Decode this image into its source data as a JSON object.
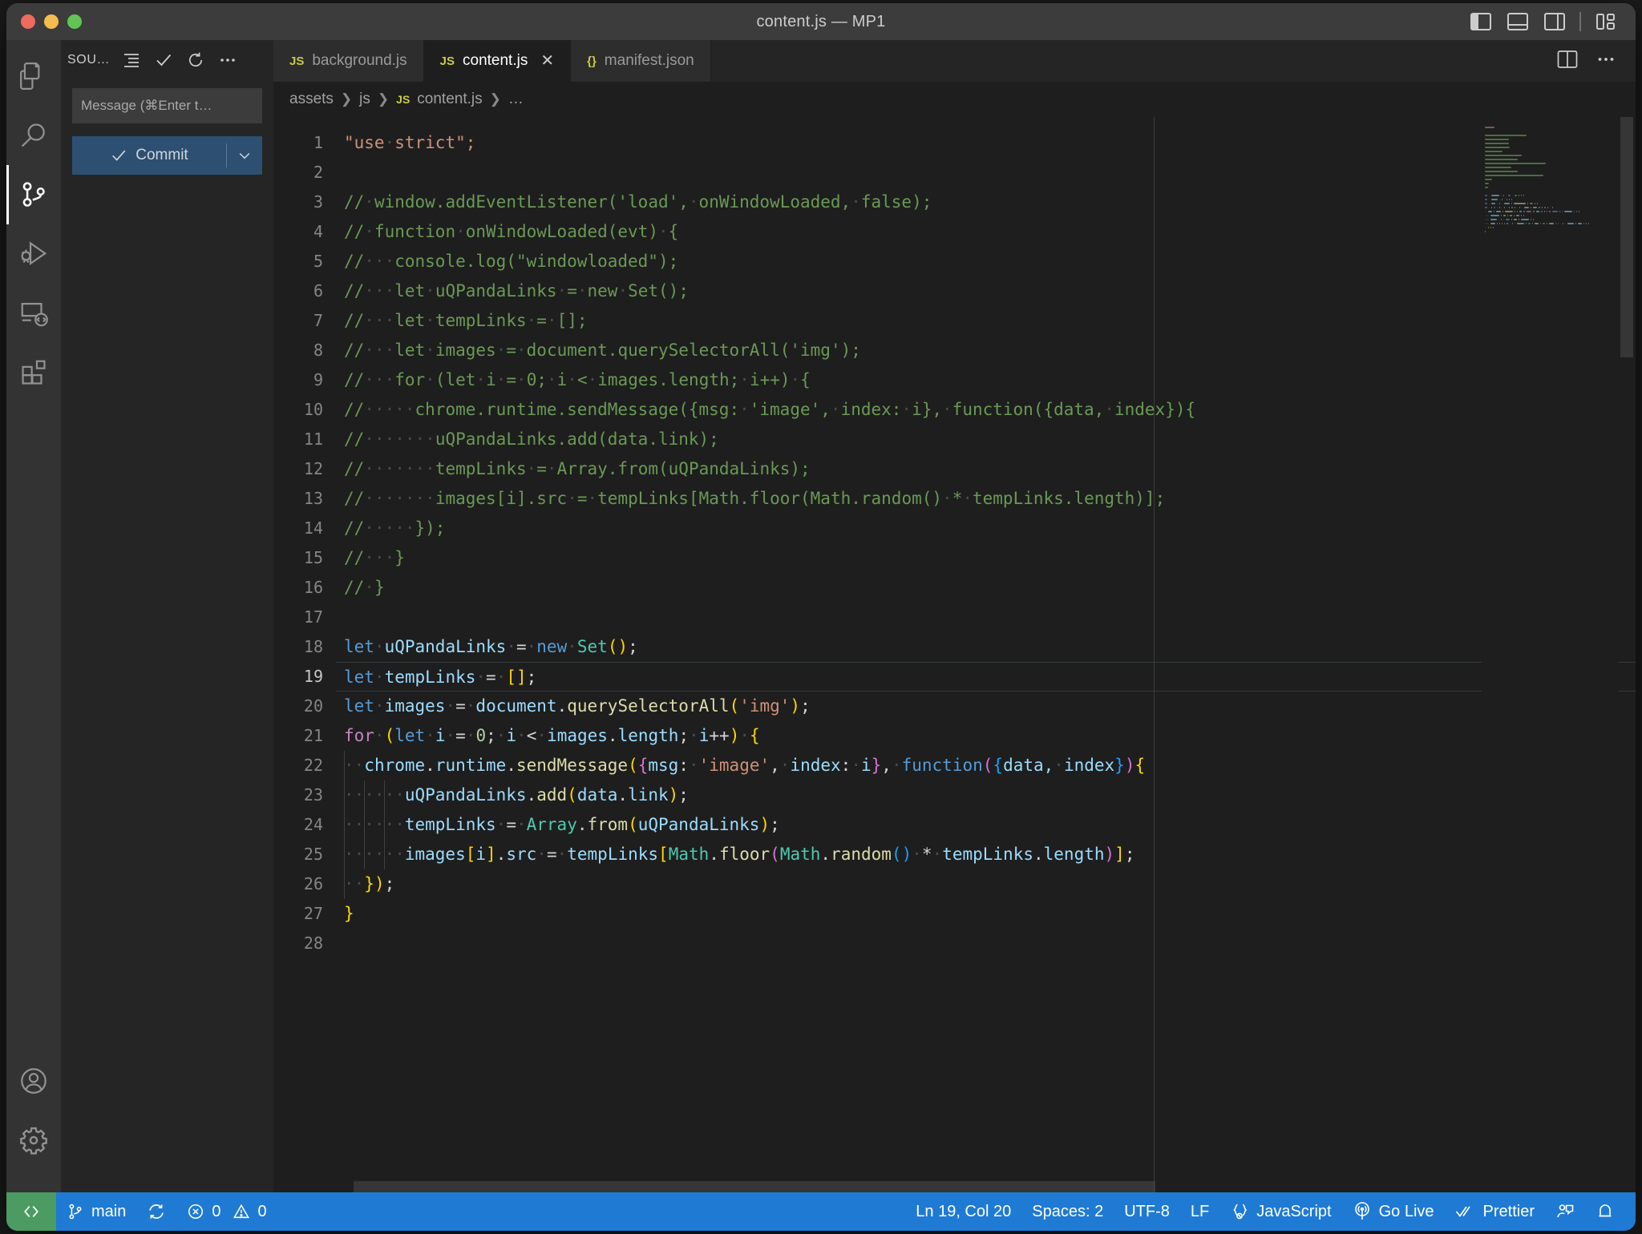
{
  "window": {
    "title": "content.js — MP1",
    "traffic_lights": [
      "close-red",
      "minimize-yellow",
      "maximize-green"
    ],
    "layout_actions": [
      {
        "name": "toggle-primary-sidebar",
        "state": "active"
      },
      {
        "name": "toggle-panel",
        "state": "inactive"
      },
      {
        "name": "toggle-secondary-sidebar",
        "state": "inactive"
      },
      {
        "name": "customize-layout",
        "state": "inactive"
      }
    ]
  },
  "activity_bar": {
    "items": [
      {
        "name": "explorer",
        "icon": "files-icon",
        "active": false
      },
      {
        "name": "search",
        "icon": "search-icon",
        "active": false
      },
      {
        "name": "source-control",
        "icon": "source-control-icon",
        "active": true
      },
      {
        "name": "run-and-debug",
        "icon": "run-debug-icon",
        "active": false
      },
      {
        "name": "remote-explorer",
        "icon": "remote-explorer-icon",
        "active": false
      },
      {
        "name": "extensions",
        "icon": "extensions-icon",
        "active": false
      }
    ],
    "bottom": [
      {
        "name": "accounts",
        "icon": "account-icon"
      },
      {
        "name": "manage",
        "icon": "gear-icon"
      }
    ]
  },
  "sidebar": {
    "title": "SOU…",
    "actions": [
      {
        "name": "view-as-tree",
        "icon": "list-flat-icon"
      },
      {
        "name": "commit",
        "icon": "check-icon"
      },
      {
        "name": "refresh",
        "icon": "refresh-icon"
      },
      {
        "name": "views-and-more-actions",
        "icon": "ellipsis-icon"
      }
    ],
    "message_input": {
      "value": "",
      "placeholder": "Message (⌘Enter t…"
    },
    "commit_button": {
      "label": "Commit",
      "icon": "check-icon",
      "dropdown_icon": "chevron-down-icon",
      "color": "#2d4f72"
    }
  },
  "tabs": [
    {
      "label": "background.js",
      "icon": "js-file-icon",
      "icon_text": "JS",
      "active": false,
      "closable": false
    },
    {
      "label": "content.js",
      "icon": "js-file-icon",
      "icon_text": "JS",
      "active": true,
      "closable": true,
      "close_glyph": "✕"
    },
    {
      "label": "manifest.json",
      "icon": "json-file-icon",
      "icon_text": "{}",
      "active": false,
      "closable": false
    }
  ],
  "tabbar_actions": [
    {
      "name": "split-editor-right",
      "icon": "split-editor-icon"
    },
    {
      "name": "more-editor-actions",
      "icon": "ellipsis-icon"
    }
  ],
  "breadcrumb": {
    "items": [
      "assets",
      "js",
      "content.js",
      "…"
    ],
    "file_icon_text": "JS",
    "separator": "❯"
  },
  "editor": {
    "language_icon": "js",
    "lines": [
      {
        "n": 1,
        "tokens": [
          {
            "t": "\"use·strict\";",
            "c": "t-str"
          }
        ]
      },
      {
        "n": 2,
        "tokens": []
      },
      {
        "n": 3,
        "tokens": [
          {
            "t": "//·window.addEventListener('load',·onWindowLoaded,·false);",
            "c": "t-cmt"
          }
        ]
      },
      {
        "n": 4,
        "tokens": [
          {
            "t": "//·function·onWindowLoaded(evt)·{",
            "c": "t-cmt"
          }
        ]
      },
      {
        "n": 5,
        "tokens": [
          {
            "t": "//···console.log(\"windowloaded\");",
            "c": "t-cmt"
          }
        ]
      },
      {
        "n": 6,
        "tokens": [
          {
            "t": "//···let·uQPandaLinks·=·new·Set();",
            "c": "t-cmt"
          }
        ]
      },
      {
        "n": 7,
        "tokens": [
          {
            "t": "//···let·tempLinks·=·[];",
            "c": "t-cmt"
          }
        ]
      },
      {
        "n": 8,
        "tokens": [
          {
            "t": "//···let·images·=·document.querySelectorAll('img');",
            "c": "t-cmt"
          }
        ]
      },
      {
        "n": 9,
        "tokens": [
          {
            "t": "//···for·(let·i·=·0;·i·<·images.length;·i++)·{",
            "c": "t-cmt"
          }
        ]
      },
      {
        "n": 10,
        "tokens": [
          {
            "t": "//·····chrome.runtime.sendMessage({msg:·'image',·index:·i},·function({data,·index}){",
            "c": "t-cmt"
          }
        ]
      },
      {
        "n": 11,
        "tokens": [
          {
            "t": "//·······uQPandaLinks.add(data.link);",
            "c": "t-cmt"
          }
        ]
      },
      {
        "n": 12,
        "tokens": [
          {
            "t": "//·······tempLinks·=·Array.from(uQPandaLinks);",
            "c": "t-cmt"
          }
        ]
      },
      {
        "n": 13,
        "tokens": [
          {
            "t": "//·······images[i].src·=·tempLinks[Math.floor(Math.random()·*·tempLinks.length)];",
            "c": "t-cmt"
          }
        ]
      },
      {
        "n": 14,
        "tokens": [
          {
            "t": "//·····});",
            "c": "t-cmt"
          }
        ]
      },
      {
        "n": 15,
        "tokens": [
          {
            "t": "//···}",
            "c": "t-cmt"
          }
        ]
      },
      {
        "n": 16,
        "tokens": [
          {
            "t": "//·}",
            "c": "t-cmt"
          }
        ]
      },
      {
        "n": 17,
        "tokens": []
      },
      {
        "n": 18,
        "tokens": [
          {
            "t": "let",
            "c": "t-kw"
          },
          {
            "t": "·",
            "c": "ws"
          },
          {
            "t": "uQPandaLinks",
            "c": "t-var"
          },
          {
            "t": "·",
            "c": "ws"
          },
          {
            "t": "=",
            "c": "t-pl"
          },
          {
            "t": "·",
            "c": "ws"
          },
          {
            "t": "new",
            "c": "t-kw"
          },
          {
            "t": "·",
            "c": "ws"
          },
          {
            "t": "Set",
            "c": "t-cls"
          },
          {
            "t": "(",
            "c": "t-b1"
          },
          {
            "t": ")",
            "c": "t-b1"
          },
          {
            "t": ";",
            "c": "t-pl"
          }
        ]
      },
      {
        "n": 19,
        "current": true,
        "tokens": [
          {
            "t": "let",
            "c": "t-kw"
          },
          {
            "t": "·",
            "c": "ws"
          },
          {
            "t": "tempLinks",
            "c": "t-var"
          },
          {
            "t": "·",
            "c": "ws"
          },
          {
            "t": "=",
            "c": "t-pl"
          },
          {
            "t": "·",
            "c": "ws"
          },
          {
            "t": "[",
            "c": "t-b1"
          },
          {
            "t": "]",
            "c": "t-b1"
          },
          {
            "t": ";",
            "c": "t-pl"
          }
        ]
      },
      {
        "n": 20,
        "tokens": [
          {
            "t": "let",
            "c": "t-kw"
          },
          {
            "t": "·",
            "c": "ws"
          },
          {
            "t": "images",
            "c": "t-var"
          },
          {
            "t": "·",
            "c": "ws"
          },
          {
            "t": "=",
            "c": "t-pl"
          },
          {
            "t": "·",
            "c": "ws"
          },
          {
            "t": "document",
            "c": "t-var"
          },
          {
            "t": ".",
            "c": "t-pl"
          },
          {
            "t": "querySelectorAll",
            "c": "t-fn"
          },
          {
            "t": "(",
            "c": "t-b1"
          },
          {
            "t": "'img'",
            "c": "t-str"
          },
          {
            "t": ")",
            "c": "t-b1"
          },
          {
            "t": ";",
            "c": "t-pl"
          }
        ]
      },
      {
        "n": 21,
        "tokens": [
          {
            "t": "for",
            "c": "t-ctl"
          },
          {
            "t": "·",
            "c": "ws"
          },
          {
            "t": "(",
            "c": "t-b1"
          },
          {
            "t": "let",
            "c": "t-kw"
          },
          {
            "t": "·",
            "c": "ws"
          },
          {
            "t": "i",
            "c": "t-var"
          },
          {
            "t": "·",
            "c": "ws"
          },
          {
            "t": "=",
            "c": "t-pl"
          },
          {
            "t": "·",
            "c": "ws"
          },
          {
            "t": "0",
            "c": "t-num"
          },
          {
            "t": ";·",
            "c": "t-pl"
          },
          {
            "t": "i",
            "c": "t-var"
          },
          {
            "t": "·",
            "c": "ws"
          },
          {
            "t": "<",
            "c": "t-pl"
          },
          {
            "t": "·",
            "c": "ws"
          },
          {
            "t": "images",
            "c": "t-var"
          },
          {
            "t": ".",
            "c": "t-pl"
          },
          {
            "t": "length",
            "c": "t-var"
          },
          {
            "t": ";·",
            "c": "t-pl"
          },
          {
            "t": "i",
            "c": "t-var"
          },
          {
            "t": "++",
            "c": "t-pl"
          },
          {
            "t": ")",
            "c": "t-b1"
          },
          {
            "t": "·",
            "c": "ws"
          },
          {
            "t": "{",
            "c": "t-b1"
          }
        ]
      },
      {
        "n": 22,
        "indent": 1,
        "tokens": [
          {
            "t": "··",
            "c": "ws"
          },
          {
            "t": "chrome",
            "c": "t-var"
          },
          {
            "t": ".",
            "c": "t-pl"
          },
          {
            "t": "runtime",
            "c": "t-var"
          },
          {
            "t": ".",
            "c": "t-pl"
          },
          {
            "t": "sendMessage",
            "c": "t-fn"
          },
          {
            "t": "(",
            "c": "t-b1"
          },
          {
            "t": "{",
            "c": "t-b2"
          },
          {
            "t": "msg",
            "c": "t-var"
          },
          {
            "t": ":·",
            "c": "t-pl"
          },
          {
            "t": "'image'",
            "c": "t-str"
          },
          {
            "t": ",·",
            "c": "t-pl"
          },
          {
            "t": "index",
            "c": "t-var"
          },
          {
            "t": ":·",
            "c": "t-pl"
          },
          {
            "t": "i",
            "c": "t-var"
          },
          {
            "t": "}",
            "c": "t-b2"
          },
          {
            "t": ",·",
            "c": "t-pl"
          },
          {
            "t": "function",
            "c": "t-kw"
          },
          {
            "t": "(",
            "c": "t-b2"
          },
          {
            "t": "{",
            "c": "t-b3"
          },
          {
            "t": "data,·index",
            "c": "t-var"
          },
          {
            "t": "}",
            "c": "t-b3"
          },
          {
            "t": ")",
            "c": "t-b2"
          },
          {
            "t": "{",
            "c": "t-b1"
          }
        ]
      },
      {
        "n": 23,
        "indent": 3,
        "tokens": [
          {
            "t": "······",
            "c": "ws"
          },
          {
            "t": "uQPandaLinks",
            "c": "t-var"
          },
          {
            "t": ".",
            "c": "t-pl"
          },
          {
            "t": "add",
            "c": "t-fn"
          },
          {
            "t": "(",
            "c": "t-b1"
          },
          {
            "t": "data",
            "c": "t-var"
          },
          {
            "t": ".",
            "c": "t-pl"
          },
          {
            "t": "link",
            "c": "t-var"
          },
          {
            "t": ")",
            "c": "t-b1"
          },
          {
            "t": ";",
            "c": "t-pl"
          }
        ]
      },
      {
        "n": 24,
        "indent": 3,
        "tokens": [
          {
            "t": "······",
            "c": "ws"
          },
          {
            "t": "tempLinks",
            "c": "t-var"
          },
          {
            "t": "·",
            "c": "ws"
          },
          {
            "t": "=",
            "c": "t-pl"
          },
          {
            "t": "·",
            "c": "ws"
          },
          {
            "t": "Array",
            "c": "t-cls"
          },
          {
            "t": ".",
            "c": "t-pl"
          },
          {
            "t": "from",
            "c": "t-fn"
          },
          {
            "t": "(",
            "c": "t-b1"
          },
          {
            "t": "uQPandaLinks",
            "c": "t-var"
          },
          {
            "t": ")",
            "c": "t-b1"
          },
          {
            "t": ";",
            "c": "t-pl"
          }
        ]
      },
      {
        "n": 25,
        "indent": 3,
        "tokens": [
          {
            "t": "······",
            "c": "ws"
          },
          {
            "t": "images",
            "c": "t-var"
          },
          {
            "t": "[",
            "c": "t-b1"
          },
          {
            "t": "i",
            "c": "t-var"
          },
          {
            "t": "]",
            "c": "t-b1"
          },
          {
            "t": ".",
            "c": "t-pl"
          },
          {
            "t": "src",
            "c": "t-var"
          },
          {
            "t": "·",
            "c": "ws"
          },
          {
            "t": "=",
            "c": "t-pl"
          },
          {
            "t": "·",
            "c": "ws"
          },
          {
            "t": "tempLinks",
            "c": "t-var"
          },
          {
            "t": "[",
            "c": "t-b1"
          },
          {
            "t": "Math",
            "c": "t-cls"
          },
          {
            "t": ".",
            "c": "t-pl"
          },
          {
            "t": "floor",
            "c": "t-fn"
          },
          {
            "t": "(",
            "c": "t-b2"
          },
          {
            "t": "Math",
            "c": "t-cls"
          },
          {
            "t": ".",
            "c": "t-pl"
          },
          {
            "t": "random",
            "c": "t-fn"
          },
          {
            "t": "(",
            "c": "t-b3"
          },
          {
            "t": ")",
            "c": "t-b3"
          },
          {
            "t": "·",
            "c": "ws"
          },
          {
            "t": "*",
            "c": "t-pl"
          },
          {
            "t": "·",
            "c": "ws"
          },
          {
            "t": "tempLinks",
            "c": "t-var"
          },
          {
            "t": ".",
            "c": "t-pl"
          },
          {
            "t": "length",
            "c": "t-var"
          },
          {
            "t": ")",
            "c": "t-b2"
          },
          {
            "t": "]",
            "c": "t-b1"
          },
          {
            "t": ";",
            "c": "t-pl"
          }
        ]
      },
      {
        "n": 26,
        "indent": 1,
        "tokens": [
          {
            "t": "··",
            "c": "ws"
          },
          {
            "t": "}",
            "c": "t-b1"
          },
          {
            "t": ")",
            "c": "t-b1"
          },
          {
            "t": ";",
            "c": "t-pl"
          }
        ]
      },
      {
        "n": 27,
        "tokens": [
          {
            "t": "}",
            "c": "t-b1"
          }
        ]
      },
      {
        "n": 28,
        "tokens": []
      }
    ]
  },
  "status_bar": {
    "remote": {
      "name": "open-a-remote-window",
      "icon": "remote-icon",
      "color": "#4b9b62"
    },
    "left": [
      {
        "name": "branch",
        "label": "main",
        "icon": "branch-icon"
      },
      {
        "name": "sync-changes",
        "label": "",
        "icon": "sync-icon"
      },
      {
        "name": "problems",
        "label": "0",
        "icon": "error-icon",
        "label2": "0",
        "icon2": "warning-icon"
      }
    ],
    "right": [
      {
        "name": "editor-position",
        "label": "Ln 19, Col 20"
      },
      {
        "name": "indentation",
        "label": "Spaces: 2"
      },
      {
        "name": "encoding",
        "label": "UTF-8"
      },
      {
        "name": "eol",
        "label": "LF"
      },
      {
        "name": "language-mode",
        "label": "JavaScript",
        "icon": "js-braces-icon"
      },
      {
        "name": "go-live",
        "label": "Go Live",
        "icon": "broadcast-icon"
      },
      {
        "name": "prettier",
        "label": "Prettier",
        "icon": "double-check-icon"
      },
      {
        "name": "feedback",
        "label": "",
        "icon": "feedback-icon"
      },
      {
        "name": "notifications",
        "label": "",
        "icon": "bell-icon"
      }
    ],
    "background": "#1f7ad4"
  }
}
